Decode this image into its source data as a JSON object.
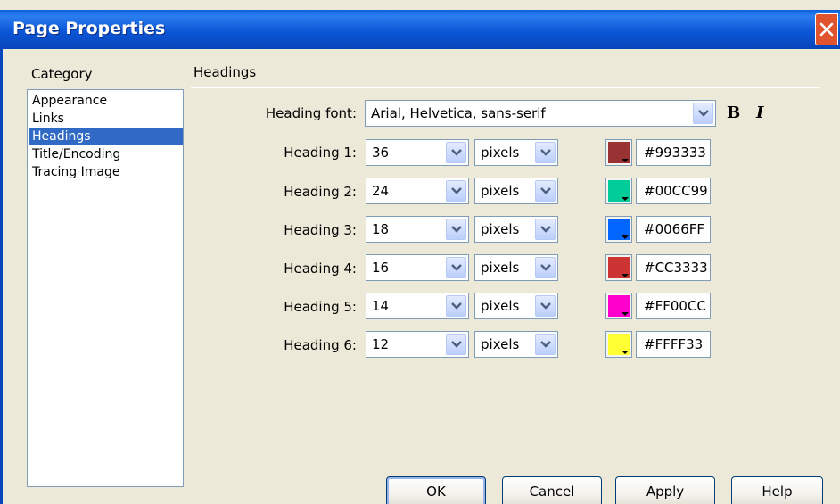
{
  "window": {
    "title": "Page Properties"
  },
  "category": {
    "header": "Category",
    "items": [
      "Appearance",
      "Links",
      "Headings",
      "Title/Encoding",
      "Tracing Image"
    ],
    "selected": "Headings"
  },
  "section": {
    "title": "Headings"
  },
  "heading_font": {
    "label": "Heading font:",
    "value": "Arial, Helvetica, sans-serif",
    "bold": "B",
    "italic": "I"
  },
  "headings": [
    {
      "label": "Heading 1:",
      "size": "36",
      "unit": "pixels",
      "color": "#993333"
    },
    {
      "label": "Heading 2:",
      "size": "24",
      "unit": "pixels",
      "color": "#00CC99"
    },
    {
      "label": "Heading 3:",
      "size": "18",
      "unit": "pixels",
      "color": "#0066FF"
    },
    {
      "label": "Heading 4:",
      "size": "16",
      "unit": "pixels",
      "color": "#CC3333"
    },
    {
      "label": "Heading 5:",
      "size": "14",
      "unit": "pixels",
      "color": "#FF00CC"
    },
    {
      "label": "Heading 6:",
      "size": "12",
      "unit": "pixels",
      "color": "#FFFF33"
    }
  ],
  "buttons": {
    "ok": "OK",
    "cancel": "Cancel",
    "apply": "Apply",
    "help": "Help"
  }
}
